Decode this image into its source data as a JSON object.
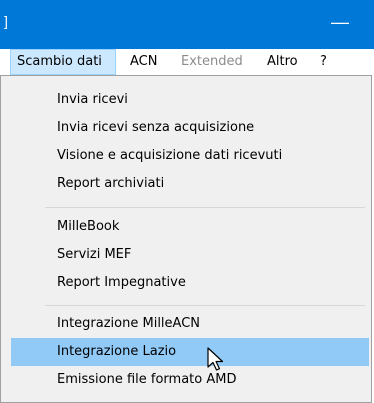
{
  "window": {
    "title_glyph": "]",
    "minimize_glyph": "—"
  },
  "menubar": {
    "items": [
      {
        "label": "Scambio dati",
        "state": "active"
      },
      {
        "label": "ACN",
        "state": "normal"
      },
      {
        "label": "Extended",
        "state": "disabled"
      },
      {
        "label": "Altro",
        "state": "normal"
      },
      {
        "label": "?",
        "state": "normal"
      }
    ]
  },
  "dropdown": {
    "groups": [
      {
        "items": [
          {
            "label": "Invia ricevi"
          },
          {
            "label": "Invia ricevi senza acquisizione"
          },
          {
            "label": "Visione e acquisizione dati ricevuti"
          },
          {
            "label": "Report archiviati"
          }
        ]
      },
      {
        "items": [
          {
            "label": "MilleBook"
          },
          {
            "label": "Servizi MEF"
          },
          {
            "label": "Report Impegnative"
          }
        ]
      },
      {
        "items": [
          {
            "label": "Integrazione MilleACN"
          },
          {
            "label": "Integrazione Lazio",
            "highlighted": true
          },
          {
            "label": "Emissione file formato AMD"
          }
        ]
      }
    ]
  },
  "colors": {
    "titlebar": "#0078d7",
    "highlight": "#91c9f7",
    "menu_active": "#cce8ff",
    "menu_bg": "#f0f0f0"
  },
  "cursor_icon": "mouse-pointer-icon"
}
